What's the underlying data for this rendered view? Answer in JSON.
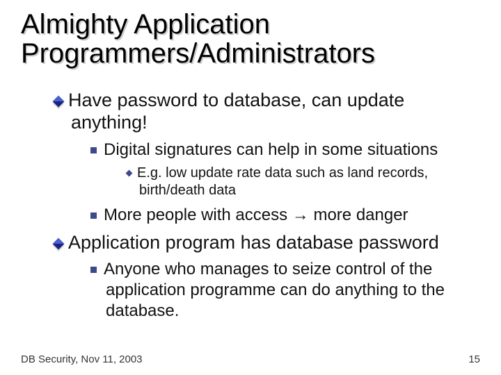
{
  "title": "Almighty Application Programmers/Administrators",
  "bullets": {
    "b1": "Have password to database, can update anything!",
    "b1_1": "Digital signatures can help in some situations",
    "b1_1_1": "E.g. low update rate data such as land records, birth/death data",
    "b1_2_pre": "More people with access ",
    "b1_2_post": " more danger",
    "b2": "Application program has database password",
    "b2_1": "Anyone who manages to seize control of the application programme can do anything to the database."
  },
  "footer": {
    "left": "DB Security, Nov 11, 2003",
    "page": "15"
  }
}
